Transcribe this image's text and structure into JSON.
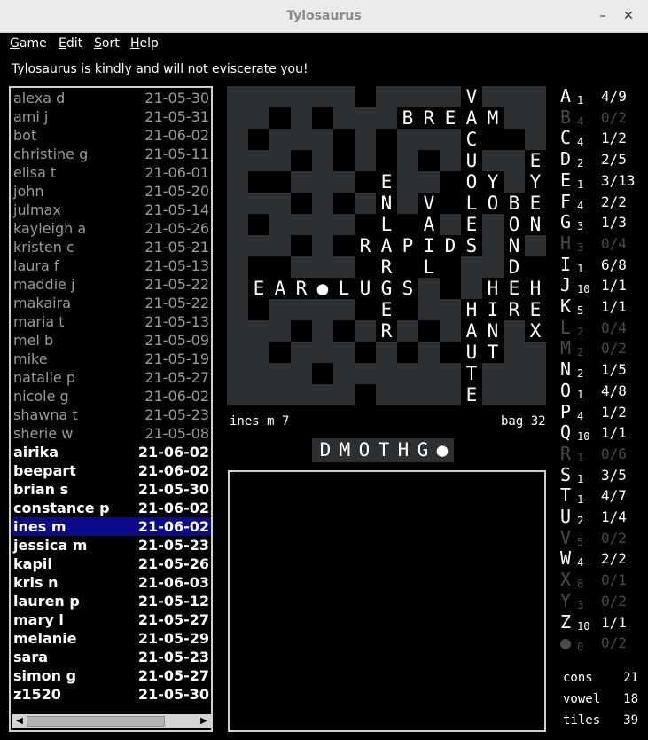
{
  "window": {
    "title": "Tylosaurus",
    "minimize": "–",
    "maximize": "□",
    "close": "✕"
  },
  "menu": [
    "Game",
    "Edit",
    "Sort",
    "Help"
  ],
  "status": "Tylosaurus is kindly and will not eviscerate you!",
  "players": [
    {
      "name": "alexa d",
      "date": "21-05-30",
      "state": "done"
    },
    {
      "name": "ami j",
      "date": "21-05-31",
      "state": "done"
    },
    {
      "name": "bot",
      "date": "21-06-02",
      "state": "done"
    },
    {
      "name": "christine g",
      "date": "21-05-11",
      "state": "done"
    },
    {
      "name": "elisa t",
      "date": "21-06-01",
      "state": "done"
    },
    {
      "name": "john",
      "date": "21-05-20",
      "state": "done"
    },
    {
      "name": "julmax",
      "date": "21-05-14",
      "state": "done"
    },
    {
      "name": "kayleigh a",
      "date": "21-05-26",
      "state": "done"
    },
    {
      "name": "kristen c",
      "date": "21-05-21",
      "state": "done"
    },
    {
      "name": "laura f",
      "date": "21-05-13",
      "state": "done"
    },
    {
      "name": "maddie j",
      "date": "21-05-22",
      "state": "done"
    },
    {
      "name": "makaira",
      "date": "21-05-22",
      "state": "done"
    },
    {
      "name": "maria t",
      "date": "21-05-13",
      "state": "done"
    },
    {
      "name": "mel b",
      "date": "21-05-09",
      "state": "done"
    },
    {
      "name": "mike",
      "date": "21-05-19",
      "state": "done"
    },
    {
      "name": "natalie p",
      "date": "21-05-27",
      "state": "done"
    },
    {
      "name": "nicole g",
      "date": "21-06-02",
      "state": "done"
    },
    {
      "name": "shawna t",
      "date": "21-05-23",
      "state": "done"
    },
    {
      "name": "sherie w",
      "date": "21-05-08",
      "state": "done"
    },
    {
      "name": "airika",
      "date": "21-06-02",
      "state": "todo"
    },
    {
      "name": "beepart",
      "date": "21-06-02",
      "state": "todo"
    },
    {
      "name": "brian s",
      "date": "21-05-30",
      "state": "todo"
    },
    {
      "name": "constance p",
      "date": "21-06-02",
      "state": "todo"
    },
    {
      "name": "ines m",
      "date": "21-06-02",
      "state": "sel"
    },
    {
      "name": "jessica m",
      "date": "21-05-23",
      "state": "todo"
    },
    {
      "name": "kapil",
      "date": "21-05-26",
      "state": "todo"
    },
    {
      "name": "kris n",
      "date": "21-06-03",
      "state": "todo"
    },
    {
      "name": "lauren p",
      "date": "21-05-12",
      "state": "todo"
    },
    {
      "name": "mary l",
      "date": "21-05-27",
      "state": "todo"
    },
    {
      "name": "melanie",
      "date": "21-05-29",
      "state": "todo"
    },
    {
      "name": "sara",
      "date": "21-05-23",
      "state": "todo"
    },
    {
      "name": "simon g",
      "date": "21-05-27",
      "state": "todo"
    },
    {
      "name": "z1520",
      "date": "21-05-30",
      "state": "todo"
    }
  ],
  "scroll": {
    "left_arrow": "◀",
    "right_arrow": "▶"
  },
  "board": {
    "size": 15,
    "tiles": [
      {
        "r": 0,
        "c": 11,
        "l": "V"
      },
      {
        "r": 1,
        "c": 8,
        "l": "B"
      },
      {
        "r": 1,
        "c": 9,
        "l": "R"
      },
      {
        "r": 1,
        "c": 10,
        "l": "E"
      },
      {
        "r": 1,
        "c": 11,
        "l": "A"
      },
      {
        "r": 1,
        "c": 12,
        "l": "M"
      },
      {
        "r": 2,
        "c": 11,
        "l": "C"
      },
      {
        "r": 3,
        "c": 11,
        "l": "U"
      },
      {
        "r": 3,
        "c": 14,
        "l": "E"
      },
      {
        "r": 4,
        "c": 7,
        "l": "E"
      },
      {
        "r": 4,
        "c": 11,
        "l": "O"
      },
      {
        "r": 4,
        "c": 12,
        "l": "Y"
      },
      {
        "r": 4,
        "c": 14,
        "l": "Y"
      },
      {
        "r": 5,
        "c": 7,
        "l": "N"
      },
      {
        "r": 5,
        "c": 9,
        "l": "V"
      },
      {
        "r": 5,
        "c": 11,
        "l": "L"
      },
      {
        "r": 5,
        "c": 12,
        "l": "O"
      },
      {
        "r": 5,
        "c": 13,
        "l": "B"
      },
      {
        "r": 5,
        "c": 14,
        "l": "E"
      },
      {
        "r": 6,
        "c": 7,
        "l": "L"
      },
      {
        "r": 6,
        "c": 9,
        "l": "A"
      },
      {
        "r": 6,
        "c": 11,
        "l": "E"
      },
      {
        "r": 6,
        "c": 13,
        "l": "O"
      },
      {
        "r": 6,
        "c": 14,
        "l": "N"
      },
      {
        "r": 7,
        "c": 6,
        "l": "R"
      },
      {
        "r": 7,
        "c": 7,
        "l": "A"
      },
      {
        "r": 7,
        "c": 8,
        "l": "P"
      },
      {
        "r": 7,
        "c": 9,
        "l": "I"
      },
      {
        "r": 7,
        "c": 10,
        "l": "D"
      },
      {
        "r": 7,
        "c": 11,
        "l": "S"
      },
      {
        "r": 7,
        "c": 13,
        "l": "N"
      },
      {
        "r": 8,
        "c": 7,
        "l": "R"
      },
      {
        "r": 8,
        "c": 9,
        "l": "L"
      },
      {
        "r": 8,
        "c": 13,
        "l": "D"
      },
      {
        "r": 9,
        "c": 1,
        "l": "E"
      },
      {
        "r": 9,
        "c": 2,
        "l": "A"
      },
      {
        "r": 9,
        "c": 3,
        "l": "R"
      },
      {
        "r": 9,
        "c": 4,
        "l": "●"
      },
      {
        "r": 9,
        "c": 5,
        "l": "L"
      },
      {
        "r": 9,
        "c": 6,
        "l": "U"
      },
      {
        "r": 9,
        "c": 7,
        "l": "G"
      },
      {
        "r": 9,
        "c": 8,
        "l": "S"
      },
      {
        "r": 9,
        "c": 12,
        "l": "H"
      },
      {
        "r": 9,
        "c": 13,
        "l": "E"
      },
      {
        "r": 9,
        "c": 14,
        "l": "H"
      },
      {
        "r": 10,
        "c": 7,
        "l": "E"
      },
      {
        "r": 10,
        "c": 11,
        "l": "H"
      },
      {
        "r": 10,
        "c": 12,
        "l": "I"
      },
      {
        "r": 10,
        "c": 13,
        "l": "R"
      },
      {
        "r": 10,
        "c": 14,
        "l": "E"
      },
      {
        "r": 11,
        "c": 7,
        "l": "R"
      },
      {
        "r": 11,
        "c": 11,
        "l": "A"
      },
      {
        "r": 11,
        "c": 12,
        "l": "N"
      },
      {
        "r": 11,
        "c": 14,
        "l": "X"
      },
      {
        "r": 12,
        "c": 11,
        "l": "U"
      },
      {
        "r": 12,
        "c": 12,
        "l": "T"
      },
      {
        "r": 13,
        "c": 11,
        "l": "T"
      },
      {
        "r": 14,
        "c": 11,
        "l": "E"
      }
    ]
  },
  "turn_info": "ines m 7",
  "bag_info": "bag 32",
  "rack": [
    "D",
    "M",
    "O",
    "T",
    "H",
    "G",
    "●"
  ],
  "letters": [
    {
      "l": "A",
      "p": "1",
      "c": "4/9",
      "on": true
    },
    {
      "l": "B",
      "p": "4",
      "c": "0/2",
      "on": false
    },
    {
      "l": "C",
      "p": "4",
      "c": "1/2",
      "on": true
    },
    {
      "l": "D",
      "p": "2",
      "c": "2/5",
      "on": true
    },
    {
      "l": "E",
      "p": "1",
      "c": "3/13",
      "on": true
    },
    {
      "l": "F",
      "p": "4",
      "c": "2/2",
      "on": true
    },
    {
      "l": "G",
      "p": "3",
      "c": "1/3",
      "on": true
    },
    {
      "l": "H",
      "p": "3",
      "c": "0/4",
      "on": false
    },
    {
      "l": "I",
      "p": "1",
      "c": "6/8",
      "on": true
    },
    {
      "l": "J",
      "p": "10",
      "c": "1/1",
      "on": true
    },
    {
      "l": "K",
      "p": "5",
      "c": "1/1",
      "on": true
    },
    {
      "l": "L",
      "p": "2",
      "c": "0/4",
      "on": false
    },
    {
      "l": "M",
      "p": "2",
      "c": "0/2",
      "on": false
    },
    {
      "l": "N",
      "p": "2",
      "c": "1/5",
      "on": true
    },
    {
      "l": "O",
      "p": "1",
      "c": "4/8",
      "on": true
    },
    {
      "l": "P",
      "p": "4",
      "c": "1/2",
      "on": true
    },
    {
      "l": "Q",
      "p": "10",
      "c": "1/1",
      "on": true
    },
    {
      "l": "R",
      "p": "1",
      "c": "0/6",
      "on": false
    },
    {
      "l": "S",
      "p": "1",
      "c": "3/5",
      "on": true
    },
    {
      "l": "T",
      "p": "1",
      "c": "4/7",
      "on": true
    },
    {
      "l": "U",
      "p": "2",
      "c": "1/4",
      "on": true
    },
    {
      "l": "V",
      "p": "5",
      "c": "0/2",
      "on": false
    },
    {
      "l": "W",
      "p": "4",
      "c": "2/2",
      "on": true
    },
    {
      "l": "X",
      "p": "8",
      "c": "0/1",
      "on": false
    },
    {
      "l": "Y",
      "p": "3",
      "c": "0/2",
      "on": false
    },
    {
      "l": "Z",
      "p": "10",
      "c": "1/1",
      "on": true
    },
    {
      "l": "●",
      "p": "0",
      "c": "0/2",
      "on": false
    }
  ],
  "totals": [
    {
      "label": "cons",
      "value": "21"
    },
    {
      "label": "vowel",
      "value": "18"
    },
    {
      "label": "tiles",
      "value": "39"
    }
  ]
}
